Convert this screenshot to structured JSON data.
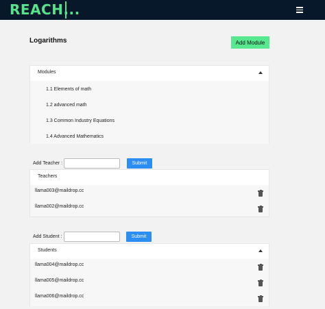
{
  "header": {
    "logo": "REACH..."
  },
  "page": {
    "title": "Logarithms",
    "add_module_label": "Add Module"
  },
  "modules": {
    "title": "Modules",
    "items": [
      {
        "label": "1.1 Elements of math"
      },
      {
        "label": "1.2 advanced math"
      },
      {
        "label": "1.3 Common Industry Equations"
      },
      {
        "label": "1.4 Advanced Mathematics"
      }
    ]
  },
  "teacher_form": {
    "label": "Add Teacher :",
    "value": "",
    "submit_label": "Submit"
  },
  "teachers": {
    "title": "Teachers",
    "items": [
      {
        "email": "llama003@maildrop.cc"
      },
      {
        "email": "llama002@maildrop.cc"
      }
    ]
  },
  "student_form": {
    "label": "Add Student :",
    "value": "",
    "submit_label": "Submit"
  },
  "students": {
    "title": "Students",
    "items": [
      {
        "email": "llama004@maildrop.cc"
      },
      {
        "email": "llama005@maildrop.cc"
      },
      {
        "email": "llama006@maildrop.cc"
      }
    ]
  },
  "icons": {
    "menu": "hamburger-icon",
    "collapse": "chevron-up-icon",
    "delete": "trash-icon"
  },
  "colors": {
    "topbar": "#07182b",
    "accent_green": "#57e890",
    "submit_blue": "#2c8df2"
  }
}
